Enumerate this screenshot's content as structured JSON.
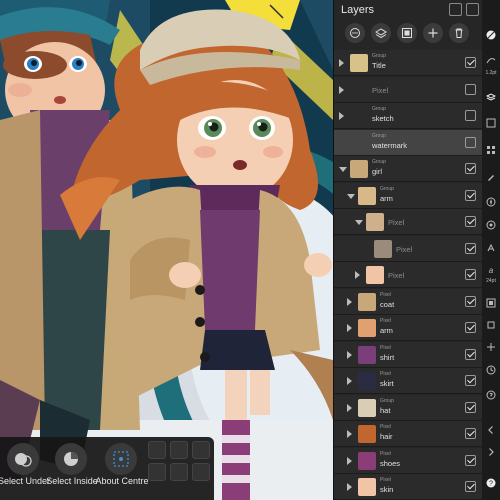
{
  "panel": {
    "title": "Layers",
    "header_icons": [
      "layers-list-icon",
      "pin-icon"
    ],
    "toolbar_icons": [
      "ellipsis-icon",
      "stack-icon",
      "mask-icon",
      "add-icon",
      "trash-icon"
    ]
  },
  "layers": [
    {
      "type": "Group",
      "name": "Title",
      "checked": true,
      "indent": 0,
      "expand": "closed",
      "thumb": "title"
    },
    {
      "type": "",
      "name": "Pixel",
      "checked": false,
      "indent": 0,
      "expand": "closed",
      "thumb": "none",
      "dim": true
    },
    {
      "type": "Group",
      "name": "sketch",
      "checked": false,
      "indent": 0,
      "expand": "closed",
      "thumb": "none"
    },
    {
      "type": "Group",
      "name": "watermark",
      "checked": false,
      "indent": 0,
      "expand": "none",
      "thumb": "none",
      "selected": true
    },
    {
      "type": "Group",
      "name": "girl",
      "checked": true,
      "indent": 0,
      "expand": "open",
      "thumb": "girl"
    },
    {
      "type": "Group",
      "name": "arm",
      "checked": true,
      "indent": 1,
      "expand": "open",
      "thumb": "arm"
    },
    {
      "type": "",
      "name": "Pixel",
      "checked": true,
      "indent": 2,
      "expand": "open",
      "thumb": "arm2",
      "dim": true
    },
    {
      "type": "",
      "name": "Pixel",
      "checked": true,
      "indent": 3,
      "expand": "none",
      "thumb": "sketch",
      "dim": true
    },
    {
      "type": "",
      "name": "Pixel",
      "checked": true,
      "indent": 2,
      "expand": "closed",
      "thumb": "fist",
      "dim": true
    },
    {
      "type": "Pixel",
      "name": "coat",
      "checked": true,
      "indent": 1,
      "expand": "closed",
      "thumb": "coat"
    },
    {
      "type": "Pixel",
      "name": "arm",
      "checked": true,
      "indent": 1,
      "expand": "closed",
      "thumb": "armp"
    },
    {
      "type": "Pixel",
      "name": "shirt",
      "checked": true,
      "indent": 1,
      "expand": "closed",
      "thumb": "shirt"
    },
    {
      "type": "Pixel",
      "name": "skirt",
      "checked": true,
      "indent": 1,
      "expand": "closed",
      "thumb": "skirt"
    },
    {
      "type": "Group",
      "name": "hat",
      "checked": true,
      "indent": 1,
      "expand": "closed",
      "thumb": "hat"
    },
    {
      "type": "Pixel",
      "name": "hair",
      "checked": true,
      "indent": 1,
      "expand": "closed",
      "thumb": "hair"
    },
    {
      "type": "Pixel",
      "name": "shoes",
      "checked": true,
      "indent": 1,
      "expand": "closed",
      "thumb": "shoes"
    },
    {
      "type": "Pixel",
      "name": "skin",
      "checked": true,
      "indent": 1,
      "expand": "closed",
      "thumb": "skin"
    }
  ],
  "selection_bar": {
    "buttons": [
      {
        "label": "Select Under",
        "icon": "select-under-icon"
      },
      {
        "label": "Select Inside",
        "icon": "select-inside-icon"
      },
      {
        "label": "About Centre",
        "icon": "about-centre-icon"
      }
    ],
    "mini_buttons": [
      "transform-icon",
      "move-icon",
      "rotate-icon",
      "scale-icon",
      "align-icon",
      "lock-icon"
    ]
  },
  "tool_strip": {
    "icons": [
      "brush-icon",
      "stroke-width-icon",
      "layers-studio-icon",
      "channels-icon",
      "swatches-icon",
      "brushes-icon",
      "navigator-icon",
      "effects-icon",
      "text-styles-icon",
      "snapping-icon",
      "history-icon",
      "transform-studio-icon",
      "help-icon",
      "collapse-icon",
      "expand-icon"
    ],
    "labels": {
      "stroke_width": "1.2pt",
      "font_size": "24pt"
    }
  },
  "colors": {
    "panel_bg": "#262626",
    "selected_row": "#444444",
    "check": "#eeeeee",
    "strip_bg": "#1b1b1b"
  }
}
